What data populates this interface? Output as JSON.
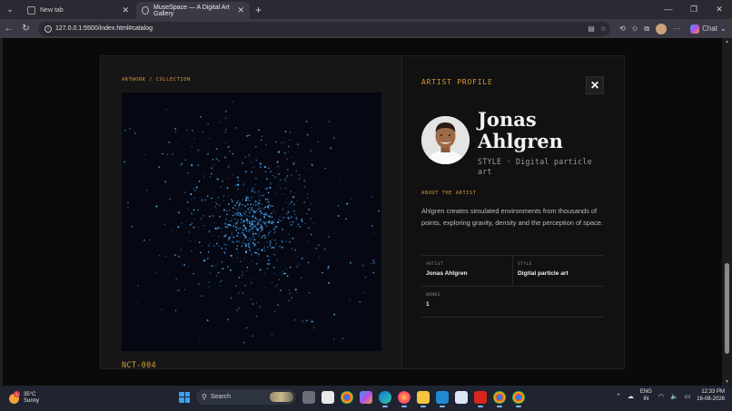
{
  "browser": {
    "tabs": [
      {
        "title": "New tab",
        "active": false
      },
      {
        "title": "MuseSpace — A Digital Art Gallery",
        "active": true
      }
    ],
    "url": "127.0.0.1:5500/index.html#catalog",
    "chat_label": "Chat"
  },
  "artwork": {
    "eyebrow": "ARTWORK / COLLECTION",
    "code": "NCT-004",
    "palette": {
      "background": "#050813",
      "particle": "#5ab8ff",
      "particle_dim": "#2a78c8"
    }
  },
  "profile": {
    "panel_title": "ARTIST PROFILE",
    "close_symbol": "✕",
    "name": "Jonas Ahlgren",
    "style_line": "STYLE · Digital particle art",
    "about_label": "ABOUT THE ARTIST",
    "about_text": "Ahlgren creates simulated environments from thousands of points, exploring gravity, density and the perception of space.",
    "meta": {
      "artist_label": "ARTIST",
      "artist_value": "Jonas Ahlgren",
      "style_label": "STYLE",
      "style_value": "Digital particle art",
      "works_label": "WORKS",
      "works_value": "1"
    }
  },
  "taskbar": {
    "temperature": "35°C",
    "condition": "Sunny",
    "weather_badge": "1",
    "search_placeholder": "Search",
    "lang_top": "ENG",
    "lang_bottom": "IN",
    "time": "12:33 PM",
    "date": "16-08-2026"
  },
  "colors": {
    "accent": "#d99a36",
    "page_bg": "#0a0a0a",
    "panel_bg": "#111111"
  }
}
